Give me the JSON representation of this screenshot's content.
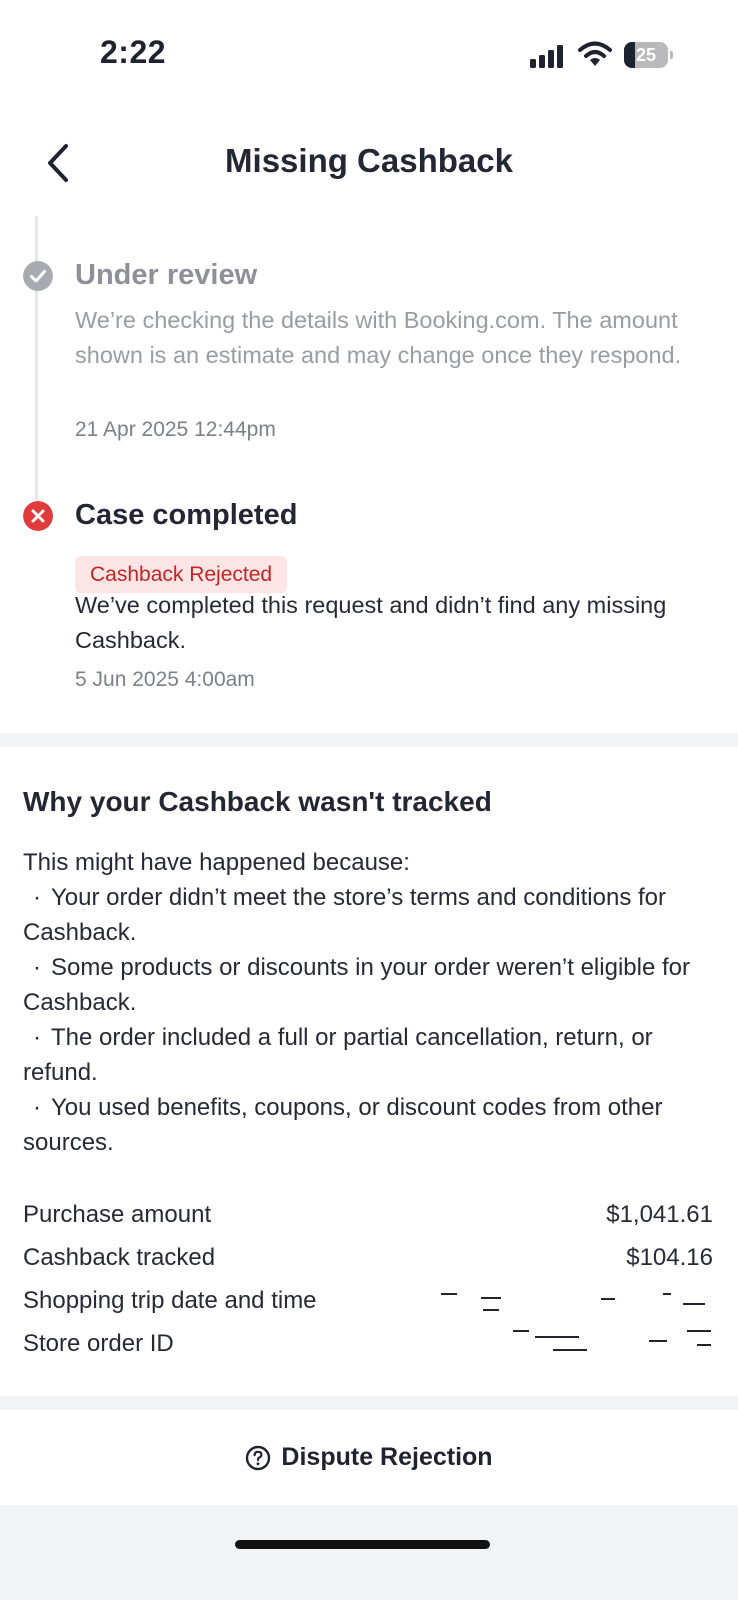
{
  "status_bar": {
    "time": "2:22",
    "battery_level": "25",
    "icons": [
      "signal-icon",
      "wifi-icon",
      "battery-icon"
    ]
  },
  "header": {
    "title": "Missing Cashback",
    "back_icon": "chevron-left-icon"
  },
  "timeline": {
    "steps": [
      {
        "icon": "check-circle-icon",
        "title": "Under review",
        "body": "We’re checking the details with Booking.com. The amount shown is an estimate and may change once they respond.",
        "date": "21 Apr 2025 12:44pm"
      },
      {
        "icon": "x-circle-icon",
        "title": "Case completed",
        "badge": "Cashback Rejected",
        "body": "We’ve completed this request and didn’t find any missing Cashback.",
        "date": "5 Jun 2025 4:00am"
      }
    ]
  },
  "why": {
    "title": "Why your Cashback wasn't tracked",
    "intro": "This might have happened because:",
    "reasons": [
      "Your order didn’t meet the store’s terms and conditions for Cashback.",
      "Some products or discounts in your order weren’t eligible for Cashback.",
      "The order included a full or partial cancellation, return, or refund.",
      "You used benefits, coupons, or discount codes from other sources."
    ]
  },
  "details": [
    {
      "label": "Purchase amount",
      "value": "$1,041.61"
    },
    {
      "label": "Cashback tracked",
      "value": "$104.16"
    },
    {
      "label": "Shopping trip date and time",
      "value": ""
    },
    {
      "label": "Store order ID",
      "value": ""
    }
  ],
  "footer": {
    "dispute_label": "Dispute Rejection",
    "dispute_icon": "help-circle-icon"
  },
  "colors": {
    "primary_text": "#1f2330",
    "muted_text": "#9a9ca3",
    "reject_red": "#e23b3b",
    "badge_bg": "#fde5e5",
    "badge_text": "#c52424"
  }
}
